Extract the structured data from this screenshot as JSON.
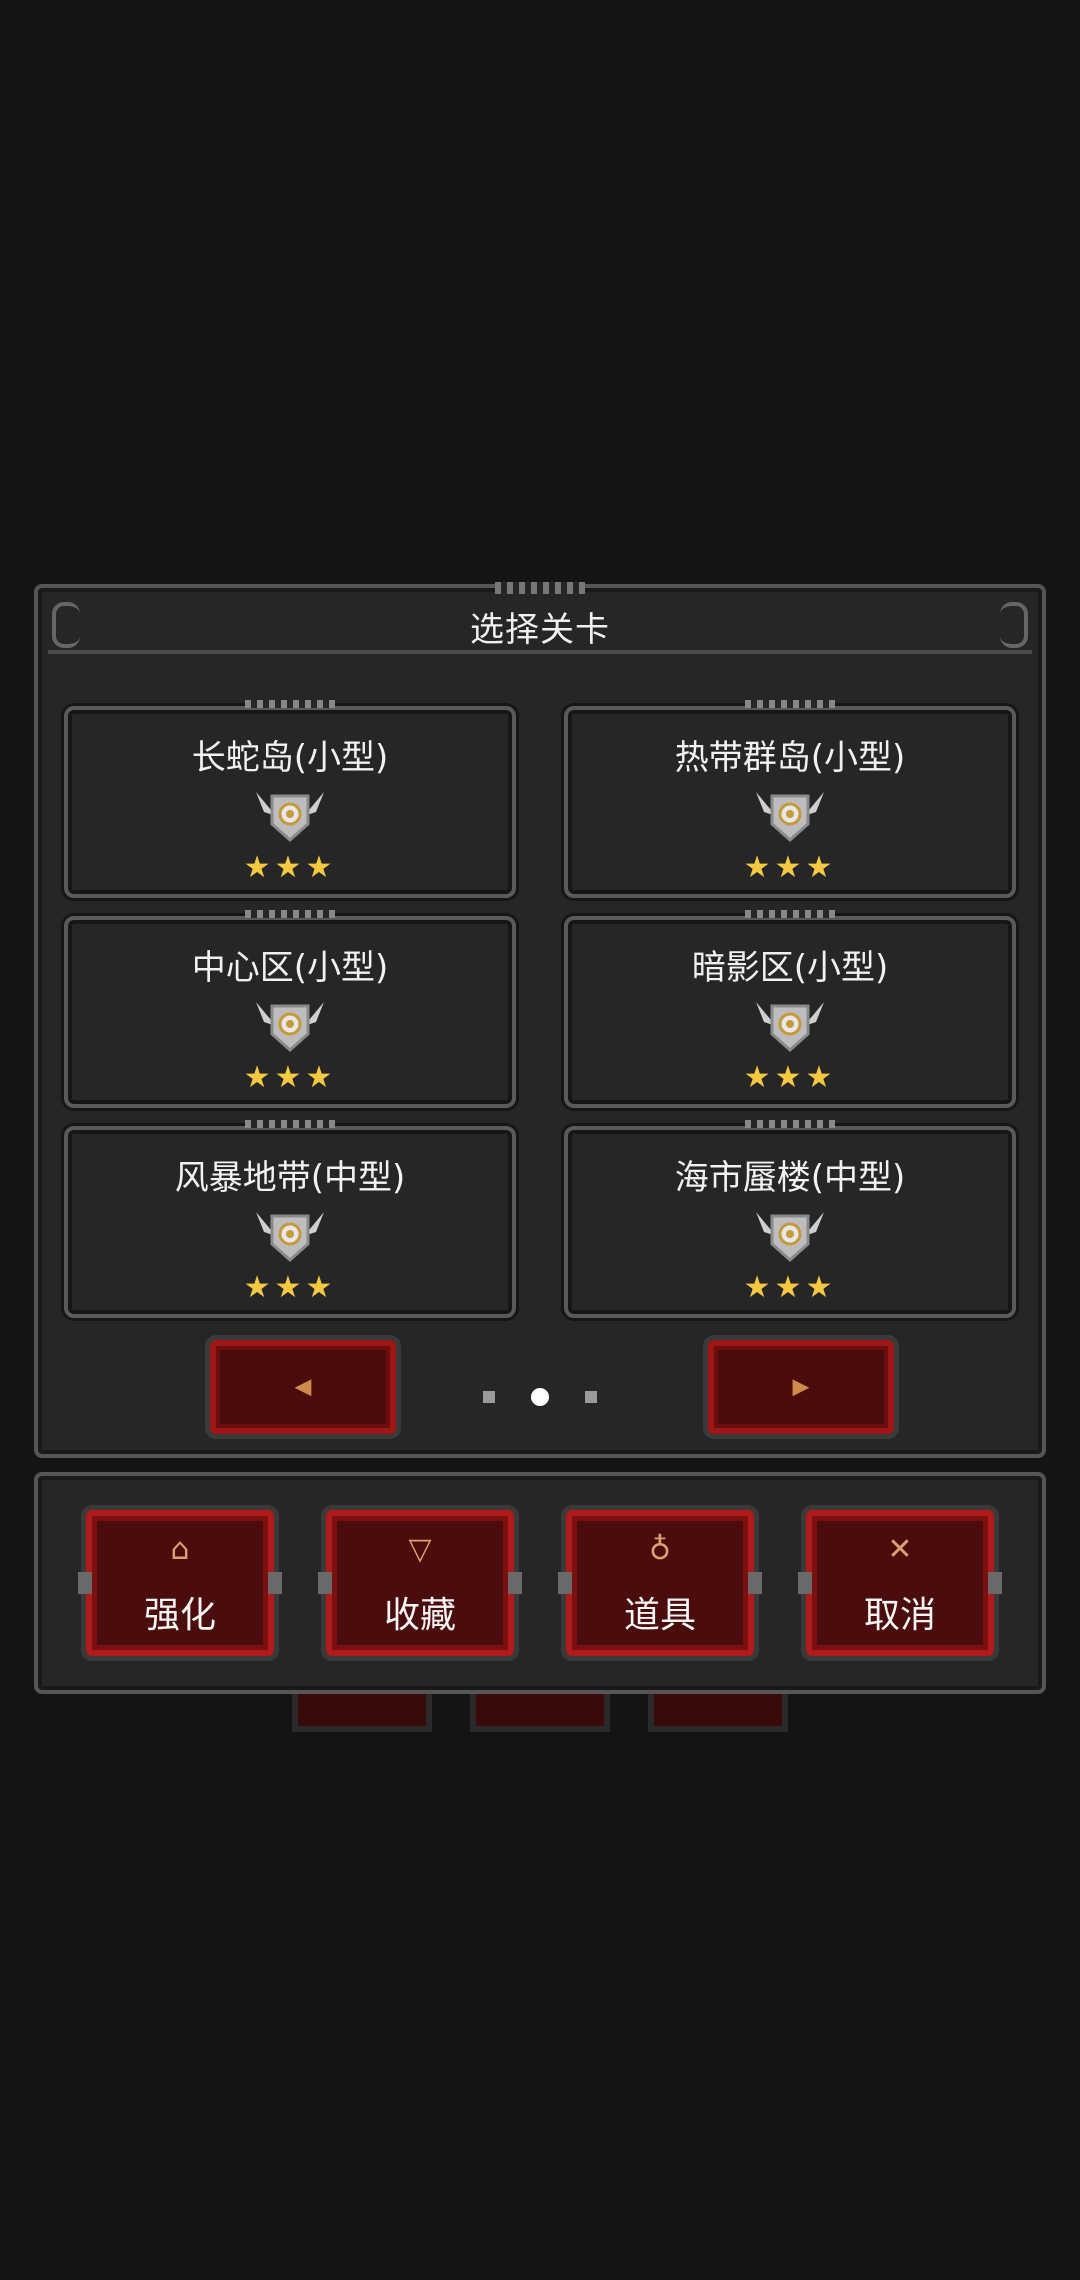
{
  "panel": {
    "title": "选择关卡",
    "levels": [
      {
        "name": "长蛇岛(小型)",
        "stars": "★★★"
      },
      {
        "name": "热带群岛(小型)",
        "stars": "★★★"
      },
      {
        "name": "中心区(小型)",
        "stars": "★★★"
      },
      {
        "name": "暗影区(小型)",
        "stars": "★★★"
      },
      {
        "name": "风暴地带(中型)",
        "stars": "★★★"
      },
      {
        "name": "海市蜃楼(中型)",
        "stars": "★★★"
      }
    ],
    "prev_icon": "◀",
    "next_icon": "▶",
    "page_count": 3,
    "current_page": 2
  },
  "actions": [
    {
      "label": "强化",
      "icon": "upgrade-icon",
      "glyph": "⌂"
    },
    {
      "label": "收藏",
      "icon": "goblet-icon",
      "glyph": "▽"
    },
    {
      "label": "道具",
      "icon": "potion-icon",
      "glyph": "♁"
    },
    {
      "label": "取消",
      "icon": "close-icon",
      "glyph": "✕"
    }
  ],
  "colors": {
    "background": "#141414",
    "panel": "#262626",
    "button": "#4a0c0c",
    "button_border": "#b01a1a",
    "star": "#f5c842"
  }
}
